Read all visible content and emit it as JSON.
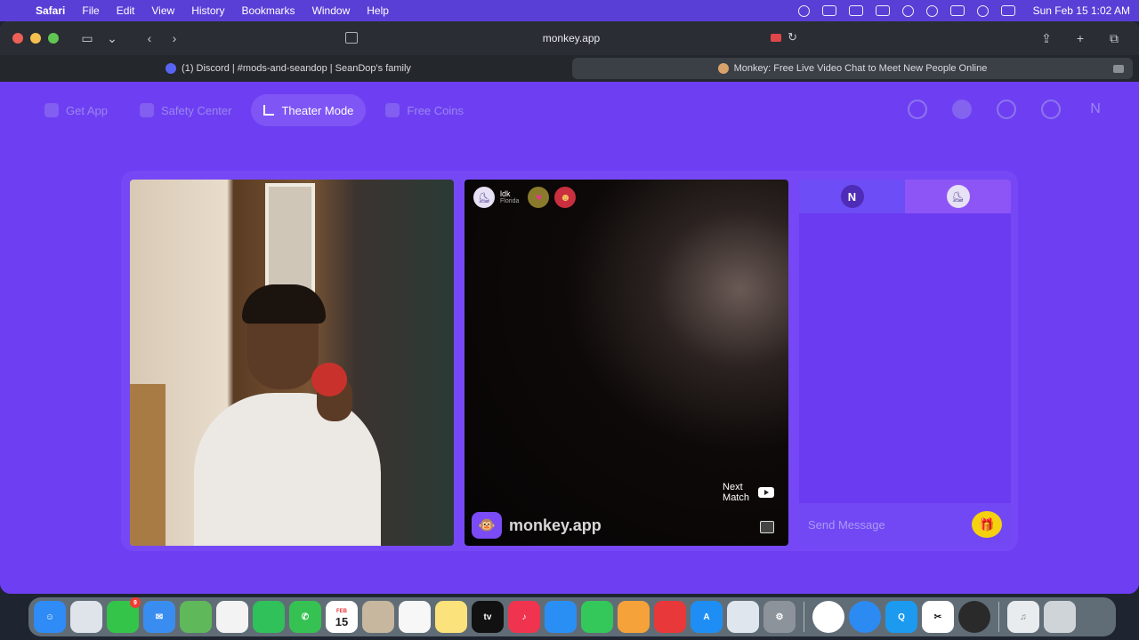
{
  "menubar": {
    "apple_icon": "apple-logo",
    "app_name": "Safari",
    "menus": [
      "File",
      "Edit",
      "View",
      "History",
      "Bookmarks",
      "Window",
      "Help"
    ],
    "clock": "Sun Feb 15  1:02 AM"
  },
  "browser": {
    "url": "monkey.app",
    "tabs": [
      {
        "title": "(1) Discord | #mods-and-seandop | SeanDop's family",
        "active": false
      },
      {
        "title": "Monkey: Free Live Video Chat to Meet New People Online",
        "active": true
      }
    ]
  },
  "nav": {
    "items": [
      {
        "label": "Get App",
        "icon": "phone-icon"
      },
      {
        "label": "Safety Center",
        "icon": "shield-icon"
      },
      {
        "label": "Theater Mode",
        "icon": "expand-icon",
        "active": true
      },
      {
        "label": "Free Coins",
        "icon": "coins-icon"
      }
    ],
    "profile_initial": "N"
  },
  "peer": {
    "name": "ldk",
    "location": "Florida",
    "next_match_label": "Next\nMatch",
    "brand": "monkey.app"
  },
  "chat": {
    "self_initial": "N",
    "input_placeholder": "Send Message"
  },
  "colors": {
    "page_bg": "#6e3ff2",
    "accent": "#7f55f5",
    "gift": "#f6d10f"
  },
  "dock": {
    "apps": [
      "Finder",
      "Launchpad",
      "Messages",
      "Mail",
      "Maps",
      "Photos",
      "FaceTime",
      "Phone",
      "Calendar",
      "Contacts",
      "Reminders",
      "Notes",
      "TV",
      "Music",
      "Keynote",
      "Numbers",
      "Pages",
      "Rocket",
      "App Store",
      "iPhone Mirroring",
      "System Settings",
      "Chrome",
      "Safari",
      "QuickTime",
      "CapCut",
      "OBS",
      "Music Library",
      "Trash"
    ],
    "calendar_day": "15",
    "calendar_month": "FEB",
    "messages_badge": "9",
    "tv_label": "tv"
  }
}
